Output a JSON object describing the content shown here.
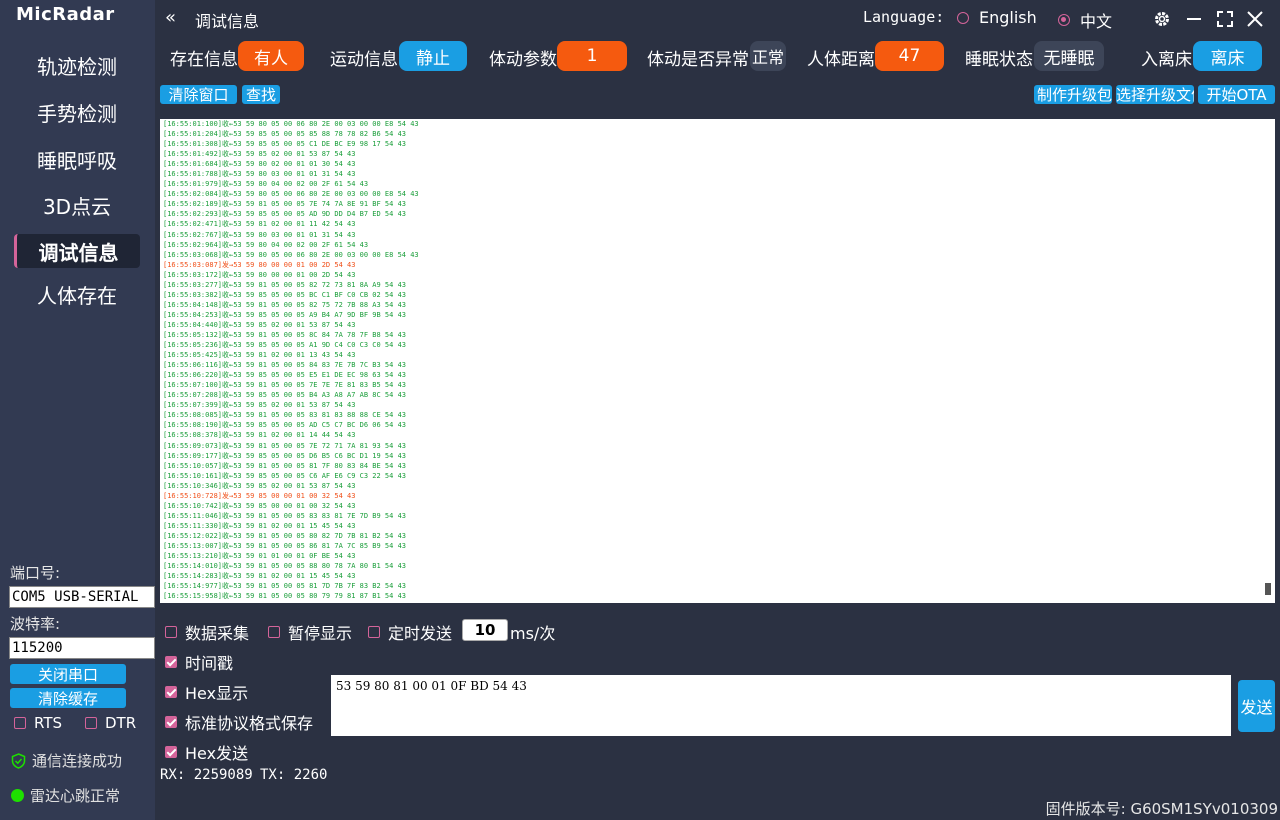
{
  "app": {
    "logo": "MicRadar",
    "title": "调试信息",
    "collapse_icon": "«"
  },
  "language": {
    "label": "Language:",
    "options": [
      "English",
      "中文"
    ],
    "selected": "中文"
  },
  "colors": {
    "accent": "#1a9ee3",
    "warn": "#f55a0f",
    "check": "#d4649a",
    "rx": "#1a9e3a",
    "tx": "#f0501a"
  },
  "sidebar": {
    "items": [
      {
        "label": "轨迹检测"
      },
      {
        "label": "手势检测"
      },
      {
        "label": "睡眠呼吸"
      },
      {
        "label": "3D点云"
      },
      {
        "label": "调试信息"
      },
      {
        "label": "人体存在"
      }
    ],
    "port_label": "端口号:",
    "port_value": "COM5 USB-SERIAL",
    "baud_label": "波特率:",
    "baud_value": "115200",
    "close_port": "关闭串口",
    "clear_cache": "清除缓存",
    "rts": "RTS",
    "dtr": "DTR",
    "conn_status": "通信连接成功",
    "heartbeat": "雷达心跳正常"
  },
  "status": {
    "presence_label": "存在信息",
    "presence_value": "有人",
    "motion_label": "运动信息",
    "motion_value": "静止",
    "body_param_label": "体动参数",
    "body_param_value": "1",
    "abnormal_label": "体动是否异常",
    "abnormal_value": "正常",
    "distance_label": "人体距离",
    "distance_value": "47",
    "sleep_label": "睡眠状态",
    "sleep_value": "无睡眠",
    "bed_label": "入离床",
    "bed_value": "离床"
  },
  "actions": {
    "clear": "清除窗口",
    "find": "查找",
    "make_pkg": "制作升级包",
    "select_pkg": "选择升级文件",
    "start_ota": "开始OTA"
  },
  "log": [
    {
      "t": "[16:55:01:100]收←53 59 80 05 00 06 80 2E 00 03 00 00 E8 54 43",
      "tx": false
    },
    {
      "t": "[16:55:01:204]收←53 59 85 05 00 05 85 88 78 78 82 B6 54 43",
      "tx": false
    },
    {
      "t": "[16:55:01:308]收←53 59 85 05 00 05 C1 DE BC E9 98 17 54 43",
      "tx": false
    },
    {
      "t": "[16:55:01:492]收←53 59 85 02 00 01 53 87 54 43",
      "tx": false
    },
    {
      "t": "[16:55:01:684]收←53 59 80 02 00 01 01 30 54 43",
      "tx": false
    },
    {
      "t": "[16:55:01:788]收←53 59 80 03 00 01 01 31 54 43",
      "tx": false
    },
    {
      "t": "[16:55:01:979]收←53 59 80 04 00 02 00 2F 61 54 43",
      "tx": false
    },
    {
      "t": "[16:55:02:084]收←53 59 80 05 00 06 80 2E 00 03 00 00 E8 54 43",
      "tx": false
    },
    {
      "t": "[16:55:02:189]收←53 59 81 05 00 05 7E 74 7A 8E 91 BF 54 43",
      "tx": false
    },
    {
      "t": "[16:55:02:293]收←53 59 85 05 00 05 AD 9D DD D4 B7 ED 54 43",
      "tx": false
    },
    {
      "t": "[16:55:02:471]收←53 59 81 02 00 01 11 42 54 43",
      "tx": false
    },
    {
      "t": "[16:55:02:767]收←53 59 80 03 00 01 01 31 54 43",
      "tx": false
    },
    {
      "t": "[16:55:02:964]收←53 59 80 04 00 02 00 2F 61 54 43",
      "tx": false
    },
    {
      "t": "[16:55:03:068]收←53 59 80 05 00 06 80 2E 00 03 00 00 E8 54 43",
      "tx": false
    },
    {
      "t": "[16:55:03:087]发→53 59 80 00 00 01 00 2D 54 43",
      "tx": true
    },
    {
      "t": "[16:55:03:172]收←53 59 80 00 00 01 00 2D 54 43",
      "tx": false
    },
    {
      "t": "[16:55:03:277]收←53 59 81 05 00 05 82 72 73 81 8A A9 54 43",
      "tx": false
    },
    {
      "t": "[16:55:03:382]收←53 59 85 05 00 05 BC C1 BF C0 CB 02 54 43",
      "tx": false
    },
    {
      "t": "[16:55:04:148]收←53 59 81 05 00 05 82 75 72 7B 88 A3 54 43",
      "tx": false
    },
    {
      "t": "[16:55:04:253]收←53 59 85 05 00 05 A9 B4 A7 9D BF 9B 54 43",
      "tx": false
    },
    {
      "t": "[16:55:04:440]收←53 59 85 02 00 01 53 87 54 43",
      "tx": false
    },
    {
      "t": "[16:55:05:132]收←53 59 81 05 00 05 8C 84 7A 78 7F B8 54 43",
      "tx": false
    },
    {
      "t": "[16:55:05:236]收←53 59 85 05 00 05 A1 9D C4 C0 C3 C0 54 43",
      "tx": false
    },
    {
      "t": "[16:55:05:425]收←53 59 81 02 00 01 13 43 54 43",
      "tx": false
    },
    {
      "t": "[16:55:06:116]收←53 59 81 05 00 05 84 83 7E 7B 7C B3 54 43",
      "tx": false
    },
    {
      "t": "[16:55:06:220]收←53 59 85 05 00 05 E5 E1 DE EC 98 63 54 43",
      "tx": false
    },
    {
      "t": "[16:55:07:100]收←53 59 81 05 00 05 7E 7E 7E 81 83 B5 54 43",
      "tx": false
    },
    {
      "t": "[16:55:07:208]收←53 59 85 05 00 05 B4 A3 A8 A7 AB 8C 54 43",
      "tx": false
    },
    {
      "t": "[16:55:07:399]收←53 59 85 02 00 01 53 87 54 43",
      "tx": false
    },
    {
      "t": "[16:55:08:085]收←53 59 81 05 00 05 83 81 83 88 88 CE 54 43",
      "tx": false
    },
    {
      "t": "[16:55:08:190]收←53 59 85 05 00 05 AD C5 C7 BC D6 06 54 43",
      "tx": false
    },
    {
      "t": "[16:55:08:378]收←53 59 81 02 00 01 14 44 54 43",
      "tx": false
    },
    {
      "t": "[16:55:09:073]收←53 59 81 05 00 05 7E 72 71 7A 81 93 54 43",
      "tx": false
    },
    {
      "t": "[16:55:09:177]收←53 59 85 05 00 05 D6 B5 C6 BC D1 19 54 43",
      "tx": false
    },
    {
      "t": "[16:55:10:057]收←53 59 81 05 00 05 81 7F 80 83 84 BE 54 43",
      "tx": false
    },
    {
      "t": "[16:55:10:161]收←53 59 85 05 00 05 C6 AF E6 C9 C3 22 54 43",
      "tx": false
    },
    {
      "t": "[16:55:10:346]收←53 59 85 02 00 01 53 87 54 43",
      "tx": false
    },
    {
      "t": "[16:55:10:728]发→53 59 85 00 00 01 00 32 54 43",
      "tx": true
    },
    {
      "t": "[16:55:10:742]收←53 59 85 00 00 01 00 32 54 43",
      "tx": false
    },
    {
      "t": "[16:55:11:046]收←53 59 81 05 00 05 83 83 81 7E 7D B9 54 43",
      "tx": false
    },
    {
      "t": "[16:55:11:330]收←53 59 81 02 00 01 15 45 54 43",
      "tx": false
    },
    {
      "t": "[16:55:12:022]收←53 59 81 05 00 05 80 82 7D 7B 81 B2 54 43",
      "tx": false
    },
    {
      "t": "[16:55:13:007]收←53 59 81 05 00 05 86 81 7A 7C 85 B9 54 43",
      "tx": false
    },
    {
      "t": "[16:55:13:210]收←53 59 01 01 00 01 0F BE 54 43",
      "tx": false
    },
    {
      "t": "[16:55:14:010]收←53 59 81 05 00 05 88 80 78 7A 80 B1 54 43",
      "tx": false
    },
    {
      "t": "[16:55:14:283]收←53 59 81 02 00 01 15 45 54 43",
      "tx": false
    },
    {
      "t": "[16:55:14:977]收←53 59 81 05 00 05 81 7D 7B 7F 83 B2 54 43",
      "tx": false
    },
    {
      "t": "[16:55:15:958]收←53 59 81 05 00 05 80 79 79 81 87 B1 54 43",
      "tx": false
    }
  ],
  "options": {
    "data_collect": "数据采集",
    "pause_display": "暂停显示",
    "timed_send": "定时发送",
    "interval": "10",
    "interval_unit": "ms/次",
    "timestamp": "时间戳",
    "hex_display": "Hex显示",
    "std_save": "标准协议格式保存",
    "hex_send": "Hex发送"
  },
  "send": {
    "text": "53 59 80 81 00 01 0F BD 54 43",
    "button": "发送"
  },
  "counters": {
    "rx": "RX: 2259089",
    "tx": "TX: 2260"
  },
  "firmware": "固件版本号: G60SM1SYv010309"
}
